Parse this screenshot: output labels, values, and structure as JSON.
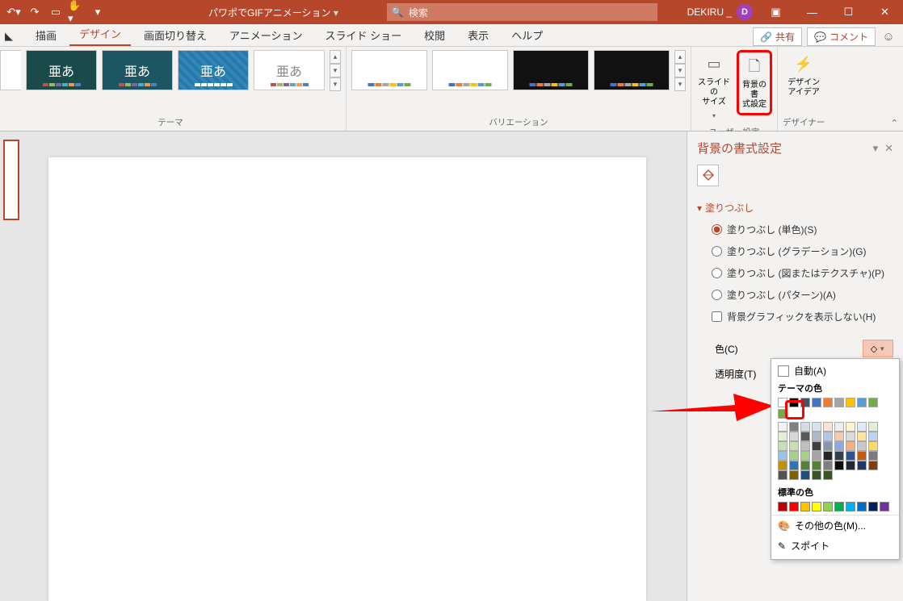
{
  "app": {
    "title": "パワポでGIFアニメーション",
    "user": "DEKIRU _",
    "avatar_letter": "D",
    "search_placeholder": "検索"
  },
  "tabs": {
    "insert": "描画",
    "design": "デザイン",
    "transition": "画面切り替え",
    "animation": "アニメーション",
    "slideshow": "スライド ショー",
    "review": "校閲",
    "view": "表示",
    "help": "ヘルプ"
  },
  "ribbon_actions": {
    "share": "共有",
    "comment": "コメント"
  },
  "ribbon": {
    "themes_label": "テーマ",
    "variations_label": "バリエーション",
    "user_settings_label": "ユーザー設定",
    "designer_label": "デザイナー",
    "slide_size": "スライドの\nサイズ",
    "format_bg": "背景の書\n式設定",
    "design_idea": "デザイン\nアイデア",
    "theme_sample": "亜あ"
  },
  "pane": {
    "title": "背景の書式設定",
    "section": "塗りつぶし",
    "fill_solid": "塗りつぶし (単色)(S)",
    "fill_gradient": "塗りつぶし (グラデーション)(G)",
    "fill_picture": "塗りつぶし (図またはテクスチャ)(P)",
    "fill_pattern": "塗りつぶし (パターン)(A)",
    "hide_bg": "背景グラフィックを表示しない(H)",
    "color_label": "色(C)",
    "transparency_label": "透明度(T)"
  },
  "color_picker": {
    "auto": "自動(A)",
    "theme_colors": "テーマの色",
    "standard_colors": "標準の色",
    "more_colors": "その他の色(M)...",
    "eyedropper": "スポイト",
    "theme_row": [
      "#ffffff",
      "#000000",
      "#44546a",
      "#4472c4",
      "#ed7d31",
      "#a5a5a5",
      "#ffc000",
      "#5b9bd5",
      "#70ad47",
      "#70ad47"
    ],
    "shades": [
      [
        "#f2f2f2",
        "#7f7f7f",
        "#d6dce4",
        "#d9e2f3",
        "#fbe4d5",
        "#ededed",
        "#fff2cc",
        "#deeaf6",
        "#e2efd9",
        "#e2efd9"
      ],
      [
        "#d8d8d8",
        "#595959",
        "#adb9ca",
        "#b4c6e7",
        "#f7caac",
        "#dbdbdb",
        "#fee599",
        "#bdd6ee",
        "#c5e0b3",
        "#c5e0b3"
      ],
      [
        "#bfbfbf",
        "#3f3f3f",
        "#8496b0",
        "#8eaadb",
        "#f4b083",
        "#c9c9c9",
        "#fed966",
        "#9cc2e5",
        "#a8d08d",
        "#a8d08d"
      ],
      [
        "#a5a5a5",
        "#262626",
        "#323f4f",
        "#2f5496",
        "#c55a11",
        "#7b7b7b",
        "#bf9000",
        "#2e75b5",
        "#538135",
        "#538135"
      ],
      [
        "#7f7f7f",
        "#0c0c0c",
        "#222a35",
        "#1f3864",
        "#833c0b",
        "#525252",
        "#7f6000",
        "#1e4e79",
        "#375623",
        "#375623"
      ]
    ],
    "standard_row": [
      "#c00000",
      "#ff0000",
      "#ffc000",
      "#ffff00",
      "#92d050",
      "#00b050",
      "#00b0f0",
      "#0070c0",
      "#002060",
      "#7030a0"
    ]
  }
}
